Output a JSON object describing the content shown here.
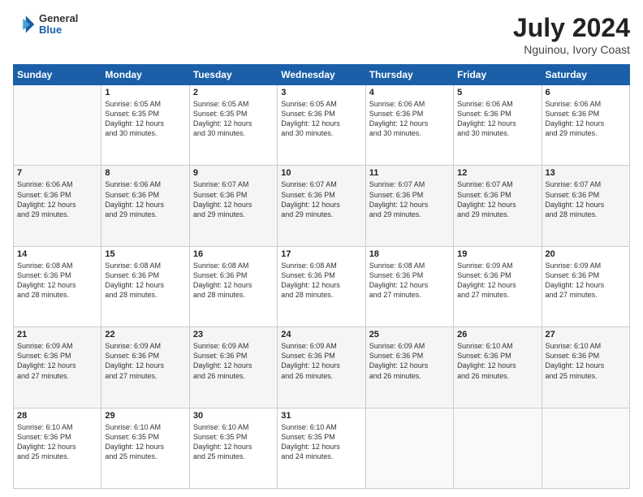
{
  "header": {
    "logo_line1": "General",
    "logo_line2": "Blue",
    "month_year": "July 2024",
    "location": "Nguinou, Ivory Coast"
  },
  "days_of_week": [
    "Sunday",
    "Monday",
    "Tuesday",
    "Wednesday",
    "Thursday",
    "Friday",
    "Saturday"
  ],
  "weeks": [
    [
      {
        "day": "",
        "sunrise": "",
        "sunset": "",
        "daylight": ""
      },
      {
        "day": "1",
        "sunrise": "6:05 AM",
        "sunset": "6:35 PM",
        "dl1": "Daylight: 12 hours",
        "dl2": "and 30 minutes."
      },
      {
        "day": "2",
        "sunrise": "6:05 AM",
        "sunset": "6:35 PM",
        "dl1": "Daylight: 12 hours",
        "dl2": "and 30 minutes."
      },
      {
        "day": "3",
        "sunrise": "6:05 AM",
        "sunset": "6:36 PM",
        "dl1": "Daylight: 12 hours",
        "dl2": "and 30 minutes."
      },
      {
        "day": "4",
        "sunrise": "6:06 AM",
        "sunset": "6:36 PM",
        "dl1": "Daylight: 12 hours",
        "dl2": "and 30 minutes."
      },
      {
        "day": "5",
        "sunrise": "6:06 AM",
        "sunset": "6:36 PM",
        "dl1": "Daylight: 12 hours",
        "dl2": "and 30 minutes."
      },
      {
        "day": "6",
        "sunrise": "6:06 AM",
        "sunset": "6:36 PM",
        "dl1": "Daylight: 12 hours",
        "dl2": "and 29 minutes."
      }
    ],
    [
      {
        "day": "7",
        "sunrise": "6:06 AM",
        "sunset": "6:36 PM",
        "dl1": "Daylight: 12 hours",
        "dl2": "and 29 minutes."
      },
      {
        "day": "8",
        "sunrise": "6:06 AM",
        "sunset": "6:36 PM",
        "dl1": "Daylight: 12 hours",
        "dl2": "and 29 minutes."
      },
      {
        "day": "9",
        "sunrise": "6:07 AM",
        "sunset": "6:36 PM",
        "dl1": "Daylight: 12 hours",
        "dl2": "and 29 minutes."
      },
      {
        "day": "10",
        "sunrise": "6:07 AM",
        "sunset": "6:36 PM",
        "dl1": "Daylight: 12 hours",
        "dl2": "and 29 minutes."
      },
      {
        "day": "11",
        "sunrise": "6:07 AM",
        "sunset": "6:36 PM",
        "dl1": "Daylight: 12 hours",
        "dl2": "and 29 minutes."
      },
      {
        "day": "12",
        "sunrise": "6:07 AM",
        "sunset": "6:36 PM",
        "dl1": "Daylight: 12 hours",
        "dl2": "and 29 minutes."
      },
      {
        "day": "13",
        "sunrise": "6:07 AM",
        "sunset": "6:36 PM",
        "dl1": "Daylight: 12 hours",
        "dl2": "and 28 minutes."
      }
    ],
    [
      {
        "day": "14",
        "sunrise": "6:08 AM",
        "sunset": "6:36 PM",
        "dl1": "Daylight: 12 hours",
        "dl2": "and 28 minutes."
      },
      {
        "day": "15",
        "sunrise": "6:08 AM",
        "sunset": "6:36 PM",
        "dl1": "Daylight: 12 hours",
        "dl2": "and 28 minutes."
      },
      {
        "day": "16",
        "sunrise": "6:08 AM",
        "sunset": "6:36 PM",
        "dl1": "Daylight: 12 hours",
        "dl2": "and 28 minutes."
      },
      {
        "day": "17",
        "sunrise": "6:08 AM",
        "sunset": "6:36 PM",
        "dl1": "Daylight: 12 hours",
        "dl2": "and 28 minutes."
      },
      {
        "day": "18",
        "sunrise": "6:08 AM",
        "sunset": "6:36 PM",
        "dl1": "Daylight: 12 hours",
        "dl2": "and 27 minutes."
      },
      {
        "day": "19",
        "sunrise": "6:09 AM",
        "sunset": "6:36 PM",
        "dl1": "Daylight: 12 hours",
        "dl2": "and 27 minutes."
      },
      {
        "day": "20",
        "sunrise": "6:09 AM",
        "sunset": "6:36 PM",
        "dl1": "Daylight: 12 hours",
        "dl2": "and 27 minutes."
      }
    ],
    [
      {
        "day": "21",
        "sunrise": "6:09 AM",
        "sunset": "6:36 PM",
        "dl1": "Daylight: 12 hours",
        "dl2": "and 27 minutes."
      },
      {
        "day": "22",
        "sunrise": "6:09 AM",
        "sunset": "6:36 PM",
        "dl1": "Daylight: 12 hours",
        "dl2": "and 27 minutes."
      },
      {
        "day": "23",
        "sunrise": "6:09 AM",
        "sunset": "6:36 PM",
        "dl1": "Daylight: 12 hours",
        "dl2": "and 26 minutes."
      },
      {
        "day": "24",
        "sunrise": "6:09 AM",
        "sunset": "6:36 PM",
        "dl1": "Daylight: 12 hours",
        "dl2": "and 26 minutes."
      },
      {
        "day": "25",
        "sunrise": "6:09 AM",
        "sunset": "6:36 PM",
        "dl1": "Daylight: 12 hours",
        "dl2": "and 26 minutes."
      },
      {
        "day": "26",
        "sunrise": "6:10 AM",
        "sunset": "6:36 PM",
        "dl1": "Daylight: 12 hours",
        "dl2": "and 26 minutes."
      },
      {
        "day": "27",
        "sunrise": "6:10 AM",
        "sunset": "6:36 PM",
        "dl1": "Daylight: 12 hours",
        "dl2": "and 25 minutes."
      }
    ],
    [
      {
        "day": "28",
        "sunrise": "6:10 AM",
        "sunset": "6:36 PM",
        "dl1": "Daylight: 12 hours",
        "dl2": "and 25 minutes."
      },
      {
        "day": "29",
        "sunrise": "6:10 AM",
        "sunset": "6:35 PM",
        "dl1": "Daylight: 12 hours",
        "dl2": "and 25 minutes."
      },
      {
        "day": "30",
        "sunrise": "6:10 AM",
        "sunset": "6:35 PM",
        "dl1": "Daylight: 12 hours",
        "dl2": "and 25 minutes."
      },
      {
        "day": "31",
        "sunrise": "6:10 AM",
        "sunset": "6:35 PM",
        "dl1": "Daylight: 12 hours",
        "dl2": "and 24 minutes."
      },
      {
        "day": "",
        "sunrise": "",
        "sunset": "",
        "dl1": "",
        "dl2": ""
      },
      {
        "day": "",
        "sunrise": "",
        "sunset": "",
        "dl1": "",
        "dl2": ""
      },
      {
        "day": "",
        "sunrise": "",
        "sunset": "",
        "dl1": "",
        "dl2": ""
      }
    ]
  ]
}
